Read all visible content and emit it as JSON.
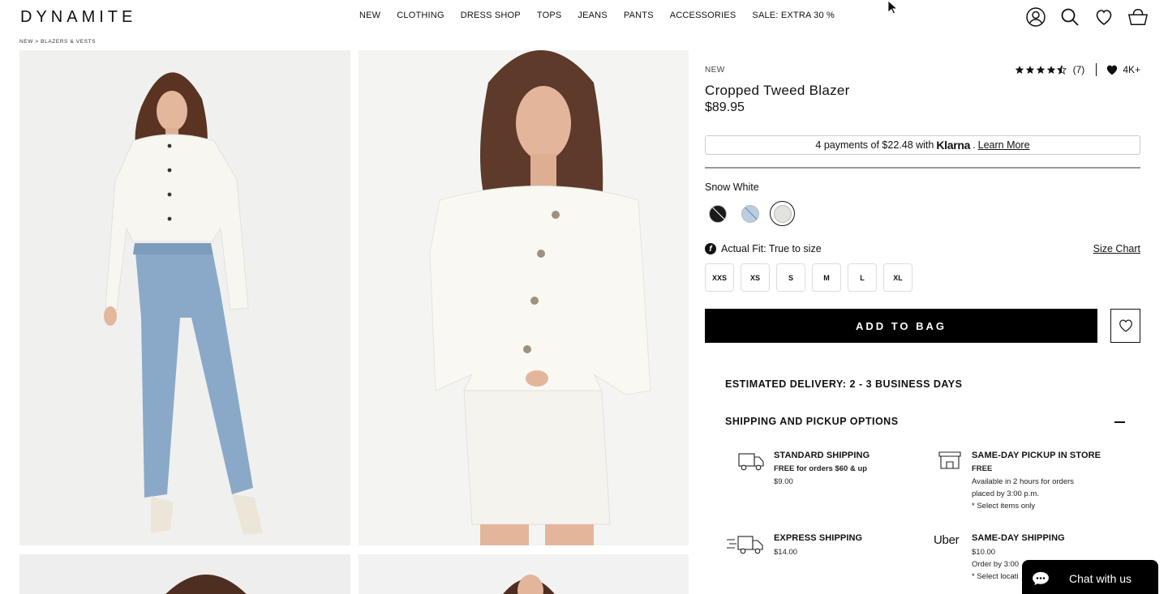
{
  "brand": "DYNAMITE",
  "nav": [
    "NEW",
    "CLOTHING",
    "DRESS SHOP",
    "TOPS",
    "JEANS",
    "PANTS",
    "ACCESSORIES",
    "SALE: EXTRA 30 %"
  ],
  "header_icons": [
    "account-icon",
    "search-icon",
    "heart-icon",
    "bag-icon"
  ],
  "breadcrumb": "NEW > BLAZERS & VESTS",
  "product": {
    "tag": "NEW",
    "title": "Cropped Tweed Blazer",
    "price": "$89.95",
    "rating_value": 4.5,
    "review_count": "(7)",
    "wishlist_count": "4K+",
    "klarna": {
      "prefix": "4 payments of $22.48 with",
      "brand": "Klarna",
      "suffix": ".",
      "link": "Learn More"
    },
    "color_name": "Snow White",
    "swatches": [
      {
        "name": "Black",
        "color": "#1a1a1a"
      },
      {
        "name": "Light Blue",
        "color": "#b9cde3"
      },
      {
        "name": "Snow White",
        "color": "#e3e3de",
        "selected": true
      }
    ],
    "fit_label": "Actual Fit: True to size",
    "size_chart": "Size Chart",
    "sizes": [
      "XXS",
      "XS",
      "S",
      "M",
      "L",
      "XL"
    ],
    "add_to_bag": "ADD TO BAG"
  },
  "delivery": "ESTIMATED DELIVERY: 2 - 3 BUSINESS DAYS",
  "shipping": {
    "title": "SHIPPING AND PICKUP OPTIONS",
    "options": [
      {
        "icon": "truck-icon",
        "title": "STANDARD SHIPPING",
        "lines": [
          "FREE for orders $60 & up",
          "$9.00"
        ]
      },
      {
        "icon": "store-icon",
        "title": "SAME-DAY PICKUP IN STORE",
        "lines": [
          "FREE",
          "Available in 2 hours for orders",
          "placed by 3:00 p.m.",
          "* Select items only"
        ]
      },
      {
        "icon": "fast-truck-icon",
        "title": "EXPRESS SHIPPING",
        "lines": [
          "$14.00"
        ]
      },
      {
        "icon": "uber-logo",
        "logo_text": "Uber",
        "title": "SAME-DAY SHIPPING",
        "lines": [
          "$10.00",
          "Order by 3:00",
          "* Select locati"
        ]
      }
    ]
  },
  "chat": {
    "label": "Chat with us"
  },
  "colors": {
    "accent": "#000000",
    "border": "#cccccc",
    "photo_bg": "#f1f1f1"
  }
}
